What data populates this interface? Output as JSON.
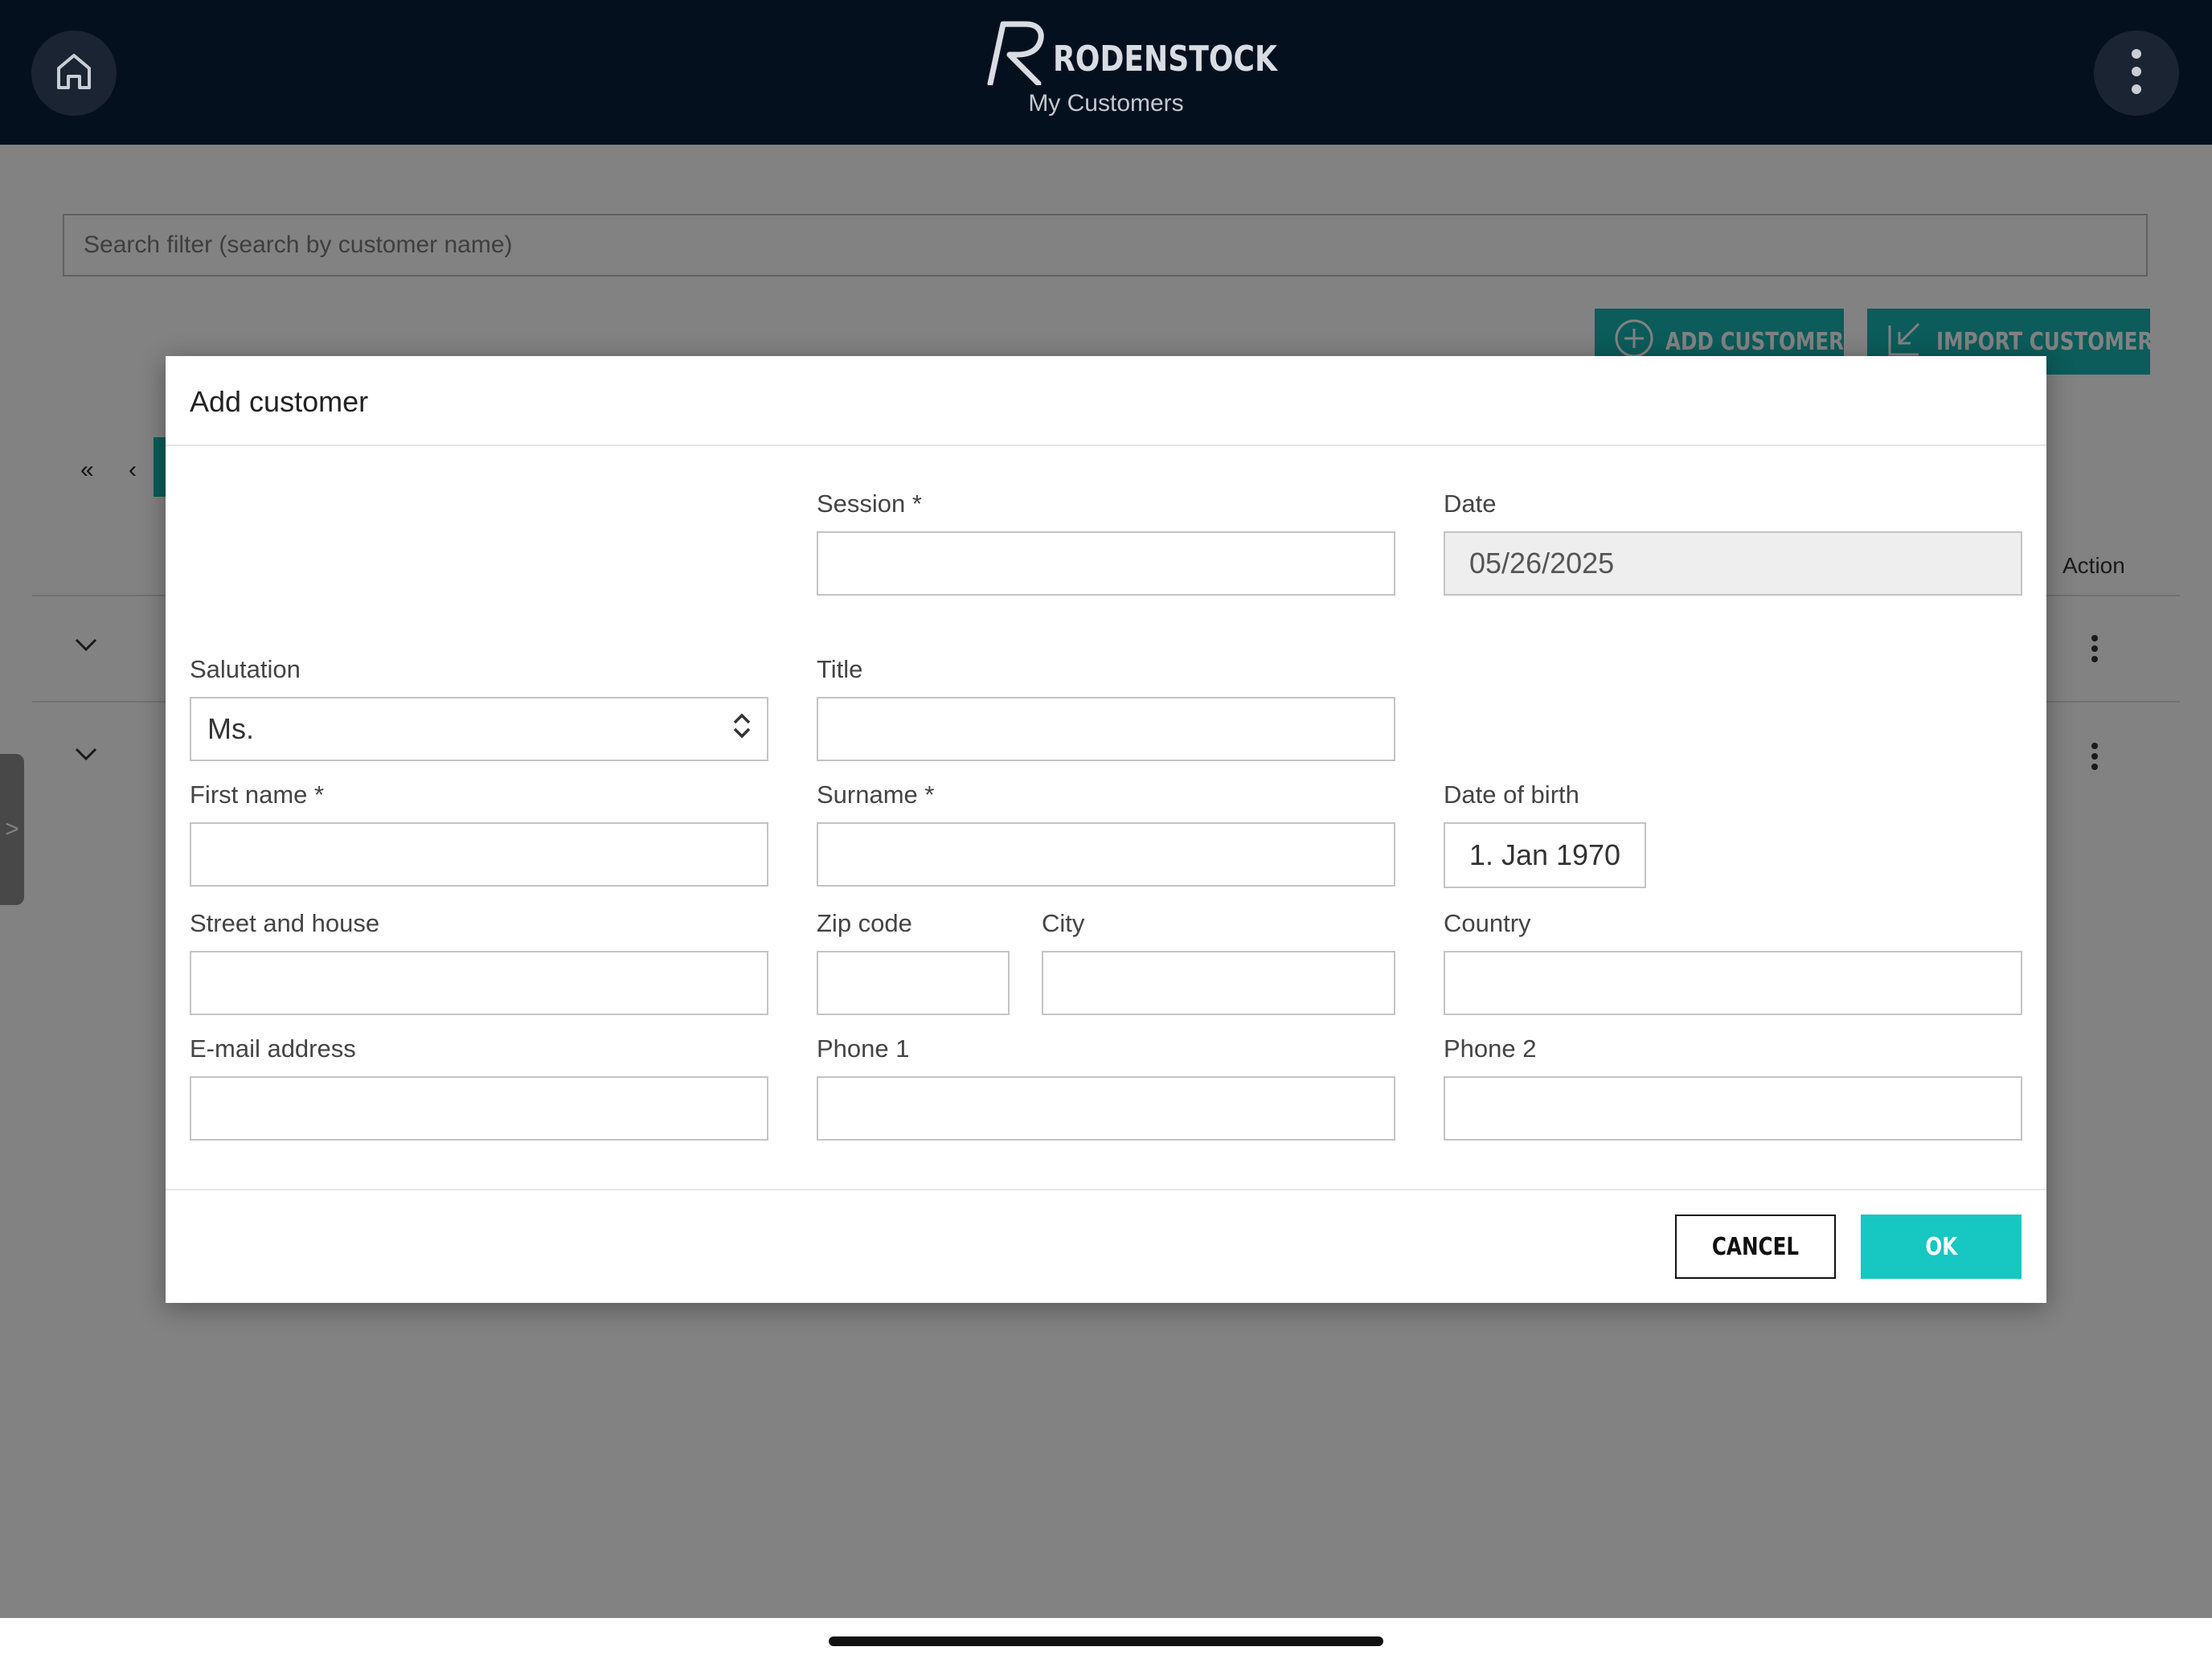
{
  "header": {
    "brand": "RODENSTOCK",
    "subtitle": "My Customers",
    "home_icon": "home-icon",
    "menu_icon": "kebab-menu-icon",
    "background": "#05101f"
  },
  "page": {
    "search_placeholder": "Search filter (search by customer name)",
    "add_customer_label": "ADD CUSTOMER",
    "import_customer_label": "IMPORT CUSTOMER",
    "pager_first": "«",
    "pager_prev": "‹",
    "action_column": "Action",
    "side_tab_label": ">",
    "accent_color": "#17b5b0"
  },
  "dialog": {
    "title": "Add customer",
    "fields": {
      "session": {
        "label": "Session *",
        "value": ""
      },
      "date": {
        "label": "Date",
        "value": "05/26/2025"
      },
      "salutation": {
        "label": "Salutation",
        "value": "Ms."
      },
      "title": {
        "label": "Title",
        "value": ""
      },
      "first_name": {
        "label": "First name *",
        "value": ""
      },
      "surname": {
        "label": "Surname *",
        "value": ""
      },
      "date_of_birth": {
        "label": "Date of birth",
        "value": "1. Jan 1970"
      },
      "street": {
        "label": "Street and house",
        "value": ""
      },
      "zip": {
        "label": "Zip code",
        "value": ""
      },
      "city": {
        "label": "City",
        "value": ""
      },
      "country": {
        "label": "Country",
        "value": ""
      },
      "email": {
        "label": "E-mail address",
        "value": ""
      },
      "phone1": {
        "label": "Phone 1",
        "value": ""
      },
      "phone2": {
        "label": "Phone 2",
        "value": ""
      }
    },
    "cancel_label": "CANCEL",
    "ok_label": "OK",
    "ok_color": "#17c7c1"
  }
}
